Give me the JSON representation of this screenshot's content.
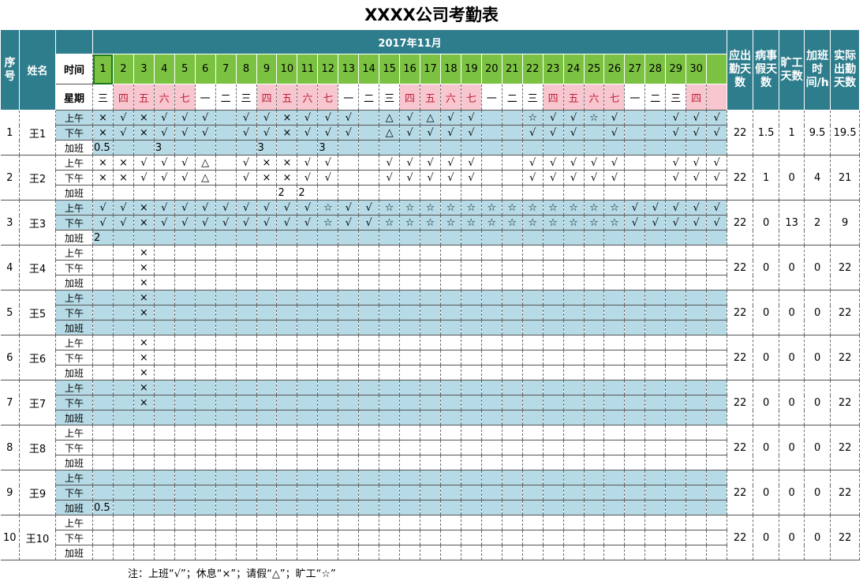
{
  "title": "XXXX公司考勤表",
  "month_label": "2017年11月",
  "headers": {
    "seq": "序号",
    "name": "姓名",
    "time": "时间",
    "weekday": "星期",
    "should_days": "应出勤天数",
    "sick_leave": "病事假天数",
    "absent": "旷工天数",
    "overtime": "加班时间/h",
    "actual_days": "实际出勤天数"
  },
  "day_numbers": [
    "1",
    "2",
    "3",
    "4",
    "5",
    "6",
    "7",
    "8",
    "9",
    "10",
    "11",
    "12",
    "13",
    "14",
    "15",
    "16",
    "17",
    "18",
    "19",
    "20",
    "21",
    "22",
    "23",
    "24",
    "25",
    "26",
    "27",
    "28",
    "29",
    "30",
    ""
  ],
  "weekdays": [
    "三",
    "四",
    "五",
    "六",
    "七",
    "一",
    "二",
    "三",
    "四",
    "五",
    "六",
    "七",
    "一",
    "二",
    "三",
    "四",
    "五",
    "六",
    "七",
    "一",
    "二",
    "三",
    "四",
    "五",
    "六",
    "七",
    "一",
    "二",
    "三",
    "四",
    ""
  ],
  "weekend_flags": [
    0,
    1,
    1,
    1,
    1,
    0,
    0,
    0,
    1,
    1,
    1,
    1,
    0,
    0,
    0,
    1,
    1,
    1,
    1,
    0,
    0,
    0,
    1,
    1,
    1,
    1,
    0,
    0,
    0,
    1,
    1
  ],
  "row_labels": [
    "上午",
    "下午",
    "加班"
  ],
  "employees": [
    {
      "seq": "1",
      "name": "王1",
      "am": [
        "×",
        "√",
        "×",
        "√",
        "√",
        "√",
        "",
        "√",
        "√",
        "×",
        "√",
        "√",
        "√",
        "",
        "△",
        "√",
        "△",
        "√",
        "√",
        "",
        "",
        "☆",
        "√",
        "√",
        "☆",
        "√",
        "",
        "",
        "√",
        "√",
        "√"
      ],
      "pm": [
        "×",
        "√",
        "×",
        "√",
        "√",
        "√",
        "",
        "√",
        "√",
        "×",
        "√",
        "√",
        "√",
        "",
        "△",
        "√",
        "√",
        "√",
        "√",
        "",
        "",
        "√",
        "√",
        "√",
        "",
        "√",
        "",
        "",
        "√",
        "√",
        "√"
      ],
      "ot": [
        "0.5",
        "",
        "",
        "3",
        "",
        "",
        "",
        "",
        "3",
        "",
        "",
        "3",
        "",
        "",
        "",
        "",
        "",
        "",
        "",
        "",
        "",
        "",
        "",
        "",
        "",
        "",
        "",
        "",
        "",
        "",
        ""
      ],
      "should": "22",
      "sick": "1.5",
      "absent": "1",
      "overtime": "9.5",
      "actual": "19.5"
    },
    {
      "seq": "2",
      "name": "王2",
      "am": [
        "×",
        "×",
        "√",
        "√",
        "√",
        "△",
        "",
        "√",
        "×",
        "×",
        "√",
        "√",
        "",
        "",
        "√",
        "√",
        "√",
        "√",
        "√",
        "",
        "",
        "√",
        "√",
        "√",
        "√",
        "√",
        "",
        "",
        "√",
        "√",
        "√"
      ],
      "pm": [
        "×",
        "×",
        "√",
        "√",
        "√",
        "△",
        "",
        "√",
        "×",
        "×",
        "√",
        "√",
        "",
        "",
        "√",
        "√",
        "√",
        "√",
        "√",
        "",
        "",
        "√",
        "√",
        "√",
        "√",
        "√",
        "",
        "",
        "√",
        "√",
        "√"
      ],
      "ot": [
        "",
        "",
        "",
        "",
        "",
        "",
        "",
        "",
        "",
        "2",
        "2",
        "",
        "",
        "",
        "",
        "",
        "",
        "",
        "",
        "",
        "",
        "",
        "",
        "",
        "",
        "",
        "",
        "",
        "",
        "",
        ""
      ],
      "should": "22",
      "sick": "1",
      "absent": "0",
      "overtime": "4",
      "actual": "21"
    },
    {
      "seq": "3",
      "name": "王3",
      "am": [
        "√",
        "√",
        "×",
        "√",
        "√",
        "√",
        "√",
        "√",
        "√",
        "√",
        "√",
        "☆",
        "√",
        "√",
        "☆",
        "☆",
        "☆",
        "☆",
        "☆",
        "☆",
        "☆",
        "☆",
        "☆",
        "☆",
        "☆",
        "☆",
        "√",
        "√",
        "√",
        "√",
        "√"
      ],
      "pm": [
        "√",
        "√",
        "×",
        "√",
        "√",
        "√",
        "√",
        "√",
        "√",
        "√",
        "√",
        "☆",
        "√",
        "√",
        "☆",
        "☆",
        "☆",
        "☆",
        "☆",
        "☆",
        "☆",
        "☆",
        "☆",
        "☆",
        "☆",
        "☆",
        "√",
        "√",
        "√",
        "√",
        "√"
      ],
      "ot": [
        "2",
        "",
        "",
        "",
        "",
        "",
        "",
        "",
        "",
        "",
        "",
        "",
        "",
        "",
        "",
        "",
        "",
        "",
        "",
        "",
        "",
        "",
        "",
        "",
        "",
        "",
        "",
        "",
        "",
        "",
        ""
      ],
      "should": "22",
      "sick": "0",
      "absent": "13",
      "overtime": "2",
      "actual": "9"
    },
    {
      "seq": "4",
      "name": "王4",
      "am": [
        "",
        "",
        "×"
      ],
      "pm": [
        "",
        "",
        "×"
      ],
      "ot": [
        "",
        "",
        "×"
      ],
      "should": "22",
      "sick": "0",
      "absent": "0",
      "overtime": "0",
      "actual": "22"
    },
    {
      "seq": "5",
      "name": "王5",
      "am": [
        "",
        "",
        "×"
      ],
      "pm": [
        "",
        "",
        "×"
      ],
      "ot": [],
      "should": "22",
      "sick": "0",
      "absent": "0",
      "overtime": "0",
      "actual": "22"
    },
    {
      "seq": "6",
      "name": "王6",
      "am": [
        "",
        "",
        "×"
      ],
      "pm": [
        "",
        "",
        "×"
      ],
      "ot": [
        "",
        "",
        "×"
      ],
      "should": "22",
      "sick": "0",
      "absent": "0",
      "overtime": "0",
      "actual": "22"
    },
    {
      "seq": "7",
      "name": "王7",
      "am": [
        "",
        "",
        "×"
      ],
      "pm": [
        "",
        "",
        "×"
      ],
      "ot": [],
      "should": "22",
      "sick": "0",
      "absent": "0",
      "overtime": "0",
      "actual": "22"
    },
    {
      "seq": "8",
      "name": "王8",
      "am": [],
      "pm": [],
      "ot": [],
      "should": "22",
      "sick": "0",
      "absent": "0",
      "overtime": "0",
      "actual": "22"
    },
    {
      "seq": "9",
      "name": "王9",
      "am": [],
      "pm": [],
      "ot": [
        "0.5"
      ],
      "should": "22",
      "sick": "0",
      "absent": "0",
      "overtime": "0",
      "actual": "22"
    },
    {
      "seq": "10",
      "name": "王10",
      "am": [],
      "pm": [],
      "ot": [],
      "should": "22",
      "sick": "0",
      "absent": "0",
      "overtime": "0",
      "actual": "22"
    }
  ],
  "note": "注：上班“√”；休息“×”；请假“△”；旷工“☆”",
  "colors": {
    "header_teal": "#2e7d8c",
    "day_green": "#7cc242",
    "weekend_pink": "#f7c6cf",
    "band_blue": "#b7dbe6",
    "mark_red": "#d6201e"
  }
}
